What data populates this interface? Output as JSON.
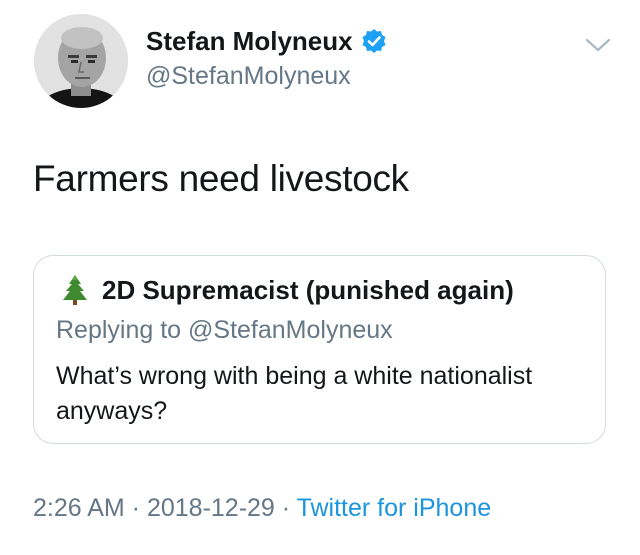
{
  "author": {
    "name": "Stefan Molyneux",
    "handle": "@StefanMolyneux",
    "verified": true
  },
  "tweet": {
    "text": "Farmers need livestock"
  },
  "quoted": {
    "name": "2D Supremacist (punished again)",
    "name_icon": "evergreen-tree-icon",
    "replying_to": "Replying to @StefanMolyneux",
    "text": "What’s wrong with being a white nationalist anyways?"
  },
  "meta": {
    "time": "2:26 AM",
    "separator": " · ",
    "date": "2018-12-29",
    "source": "Twitter for iPhone"
  },
  "icons": {
    "verified": "verified-badge-icon",
    "menu": "chevron-down-icon"
  },
  "colors": {
    "text": "#14171a",
    "secondary": "#657786",
    "link": "#1b95e0",
    "verified": "#1da1f2",
    "border": "#d4dbe0"
  }
}
